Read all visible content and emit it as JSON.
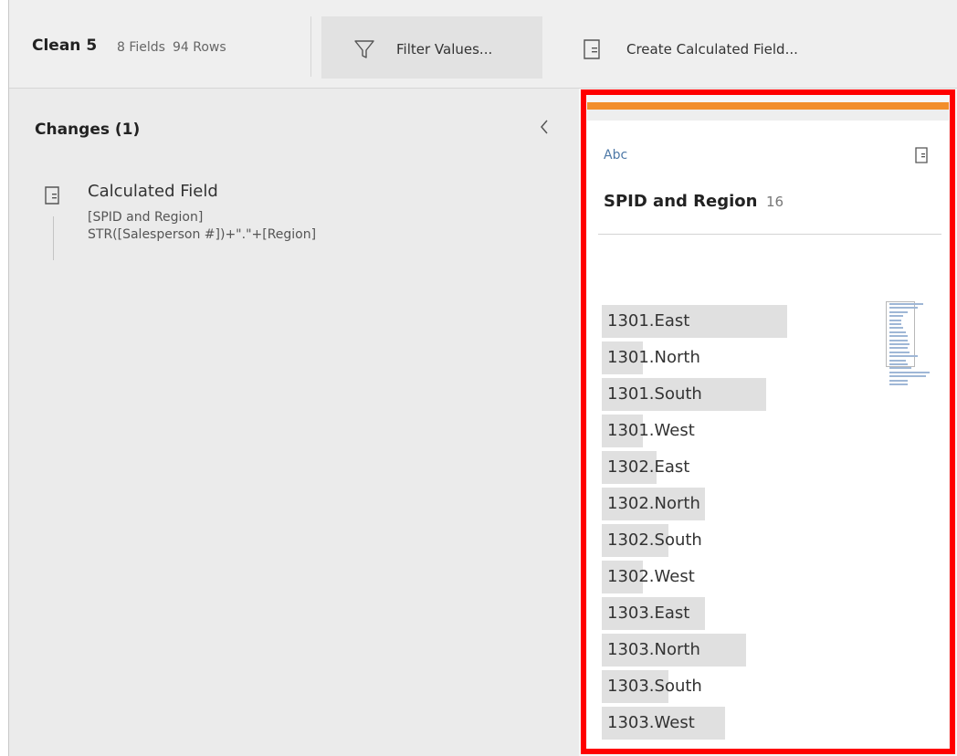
{
  "toolbar": {
    "step_title": "Clean 5",
    "fields": "8 Fields",
    "rows": "94 Rows",
    "filter_label": "Filter Values...",
    "calc_label": "Create Calculated Field..."
  },
  "changes": {
    "title": "Changes (1)",
    "collapse_icon": "chevron-left-icon",
    "items": [
      {
        "icon": "calculated-field-icon",
        "name": "Calculated Field",
        "field": "[SPID and Region]",
        "formula": "STR([Salesperson #])+\".\"+[Region]"
      }
    ]
  },
  "profile": {
    "type": "Abc",
    "field_name": "SPID and Region",
    "distinct_count": "16",
    "accent_color": "#f28e2b",
    "highlight_color": "#ff0000",
    "values": [
      {
        "label": "1301.East",
        "share": 0.81
      },
      {
        "label": "1301.North",
        "share": 0.18
      },
      {
        "label": "1301.South",
        "share": 0.72
      },
      {
        "label": "1301.West",
        "share": 0.18
      },
      {
        "label": "1302.East",
        "share": 0.24
      },
      {
        "label": "1302.North",
        "share": 0.45
      },
      {
        "label": "1302.South",
        "share": 0.29
      },
      {
        "label": "1302.West",
        "share": 0.18
      },
      {
        "label": "1303.East",
        "share": 0.45
      },
      {
        "label": "1303.North",
        "share": 0.63
      },
      {
        "label": "1303.South",
        "share": 0.29
      },
      {
        "label": "1303.West",
        "share": 0.54
      }
    ],
    "minimap_values": [
      0.85,
      0.7,
      0.45,
      0.35,
      0.3,
      0.3,
      0.35,
      0.4,
      0.45,
      0.45,
      0.5,
      0.45,
      0.5,
      0.7,
      0.4,
      0.45,
      0.55,
      1.0,
      0.9,
      0.45,
      0.45
    ]
  }
}
